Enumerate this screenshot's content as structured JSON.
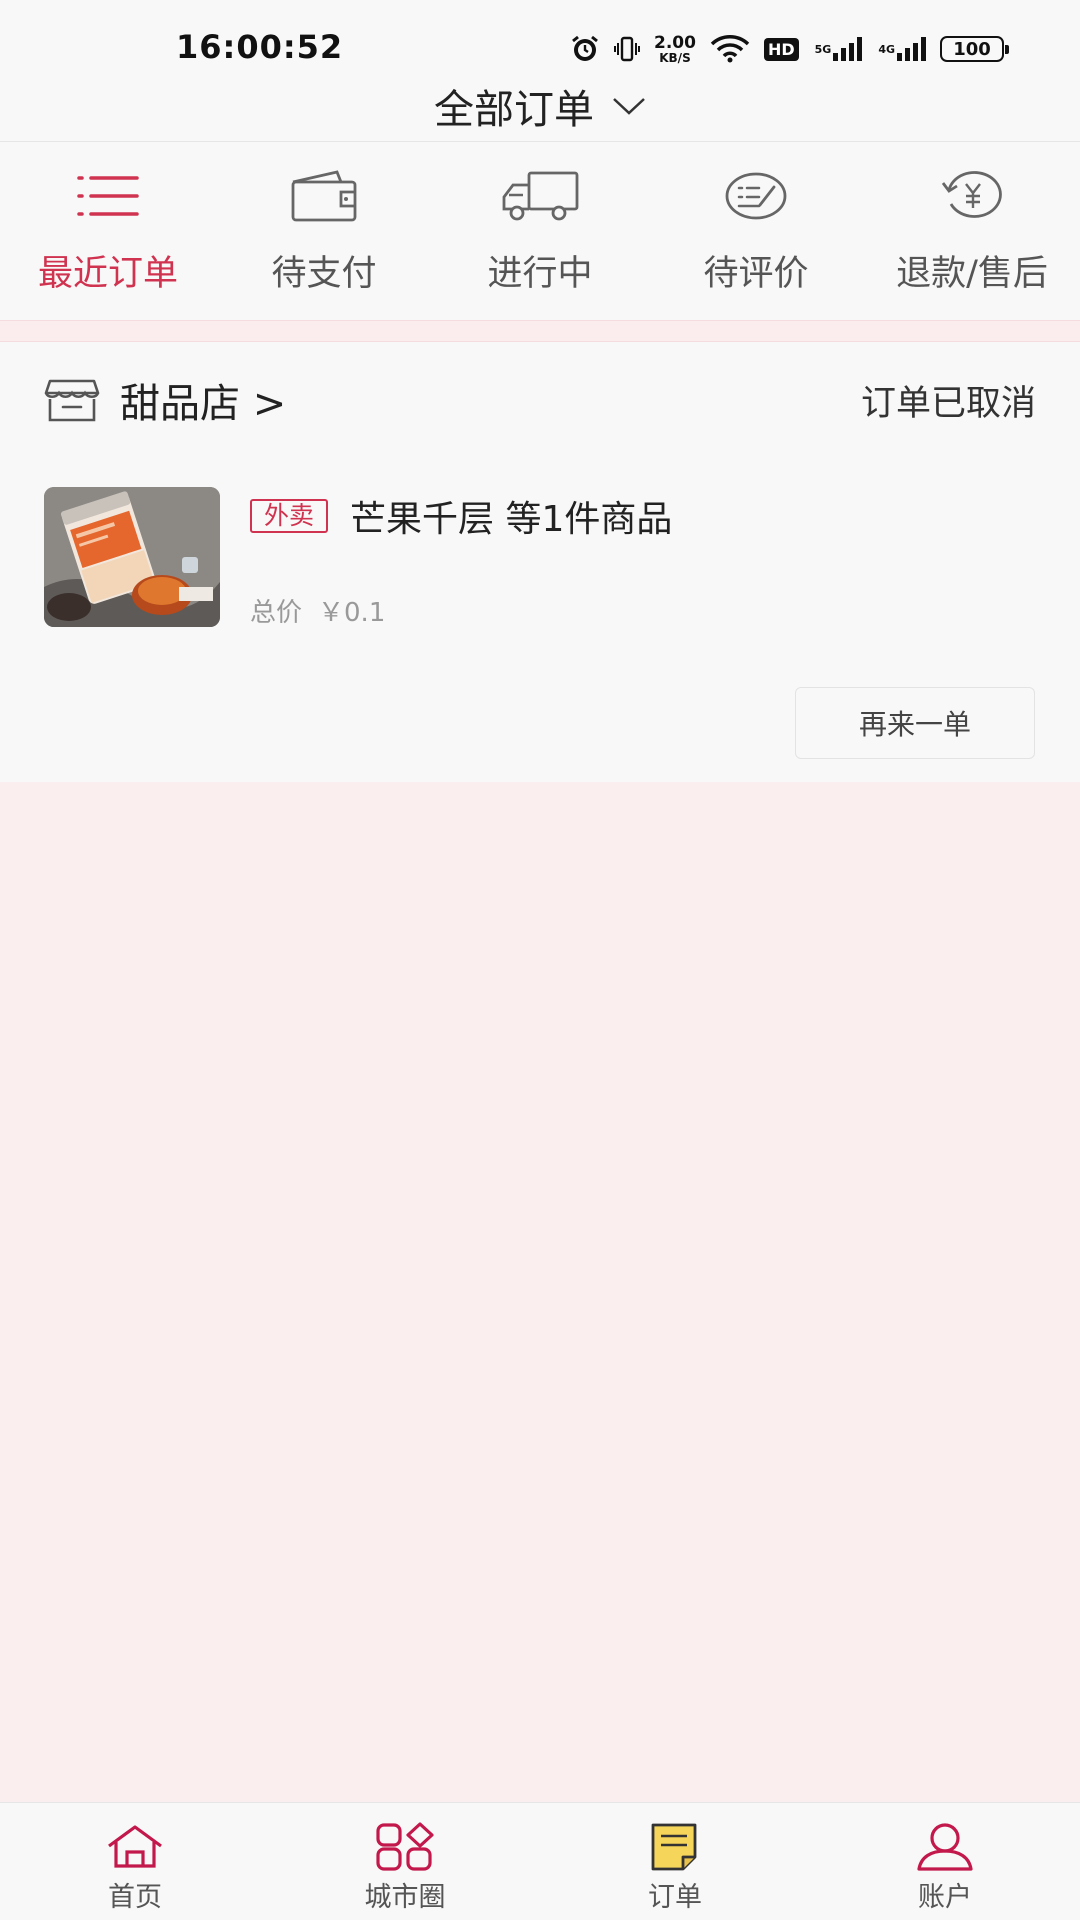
{
  "status_bar": {
    "time": "16:00:52",
    "net_speed": "2.00",
    "net_unit": "KB/S",
    "hd_label": "HD",
    "signal1_label": "5G",
    "signal2_label": "4G",
    "battery": "100"
  },
  "header": {
    "title": "全部订单"
  },
  "tabs": [
    {
      "label": "最近订单",
      "icon": "list-icon",
      "active": true
    },
    {
      "label": "待支付",
      "icon": "wallet-icon",
      "active": false
    },
    {
      "label": "进行中",
      "icon": "truck-icon",
      "active": false
    },
    {
      "label": "待评价",
      "icon": "review-icon",
      "active": false
    },
    {
      "label": "退款/售后",
      "icon": "refund-icon",
      "active": false
    }
  ],
  "order": {
    "store_name": "甜品店 >",
    "status": "订单已取消",
    "tag": "外卖",
    "item_title": "芒果千层 等1件商品",
    "price_label": "总价",
    "price_value": "￥0.1",
    "reorder_label": "再来一单"
  },
  "bottom_nav": [
    {
      "label": "首页",
      "icon": "home-icon"
    },
    {
      "label": "城市圈",
      "icon": "grid-icon"
    },
    {
      "label": "订单",
      "icon": "order-icon"
    },
    {
      "label": "账户",
      "icon": "account-icon"
    }
  ],
  "colors": {
    "accent": "#d0334f",
    "background": "#f8f8f8",
    "empty_background": "#faeeef"
  }
}
